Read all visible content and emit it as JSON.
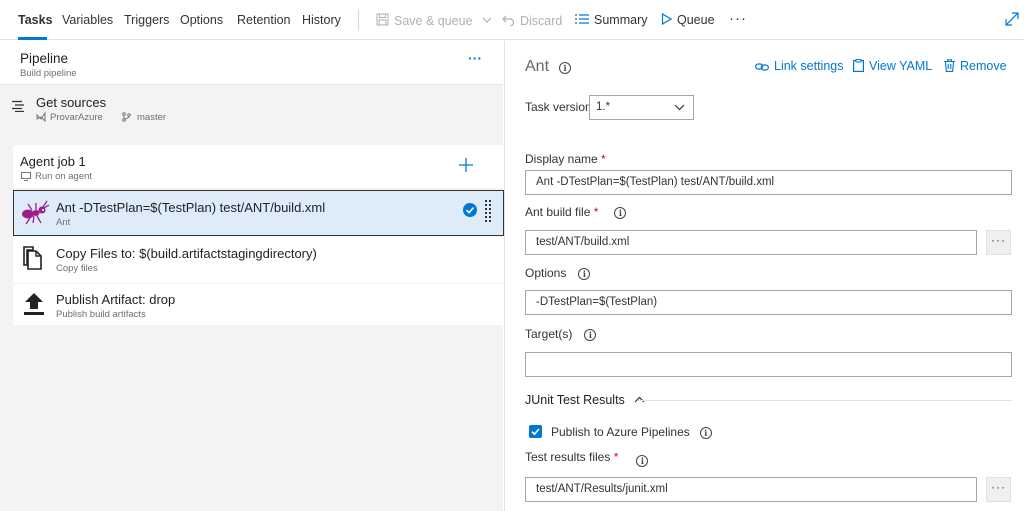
{
  "toolbar": {
    "tabs": [
      "Tasks",
      "Variables",
      "Triggers",
      "Options",
      "Retention",
      "History"
    ],
    "save_queue": "Save & queue",
    "discard": "Discard",
    "summary": "Summary",
    "queue": "Queue",
    "more": "···"
  },
  "pipeline": {
    "title": "Pipeline",
    "subtitle": "Build pipeline",
    "more": "···",
    "get_sources": "Get sources",
    "repo": "ProvarAzure",
    "branch": "master"
  },
  "agent_job": {
    "title": "Agent job 1",
    "subtitle": "Run on agent"
  },
  "tasks": [
    {
      "title": "Ant -DTestPlan=$(TestPlan) test/ANT/build.xml",
      "subtitle": "Ant"
    },
    {
      "title": "Copy Files to: $(build.artifactstagingdirectory)",
      "subtitle": "Copy files"
    },
    {
      "title": "Publish Artifact: drop",
      "subtitle": "Publish build artifacts"
    }
  ],
  "detail": {
    "heading": "Ant",
    "link_settings": "Link settings",
    "view_yaml": "View YAML",
    "remove": "Remove",
    "task_version_label": "Task version",
    "task_version_value": "1.*",
    "display_name_label": "Display name",
    "display_name_value": "Ant -DTestPlan=$(TestPlan) test/ANT/build.xml",
    "ant_build_file_label": "Ant build file",
    "ant_build_file_value": "test/ANT/build.xml",
    "options_label": "Options",
    "options_value": "-DTestPlan=$(TestPlan)",
    "targets_label": "Target(s)",
    "targets_value": "",
    "junit_section": "JUnit Test Results",
    "publish_label": "Publish to Azure Pipelines",
    "publish_checked": true,
    "test_results_label": "Test results files",
    "test_results_value": "test/ANT/Results/junit.xml",
    "browse": "···",
    "required_mark": "*"
  },
  "colors": {
    "accent": "#0078d4",
    "selected_bg": "#deecf9",
    "required": "#c50f1f",
    "ant_icon": "#9c1d8c"
  }
}
